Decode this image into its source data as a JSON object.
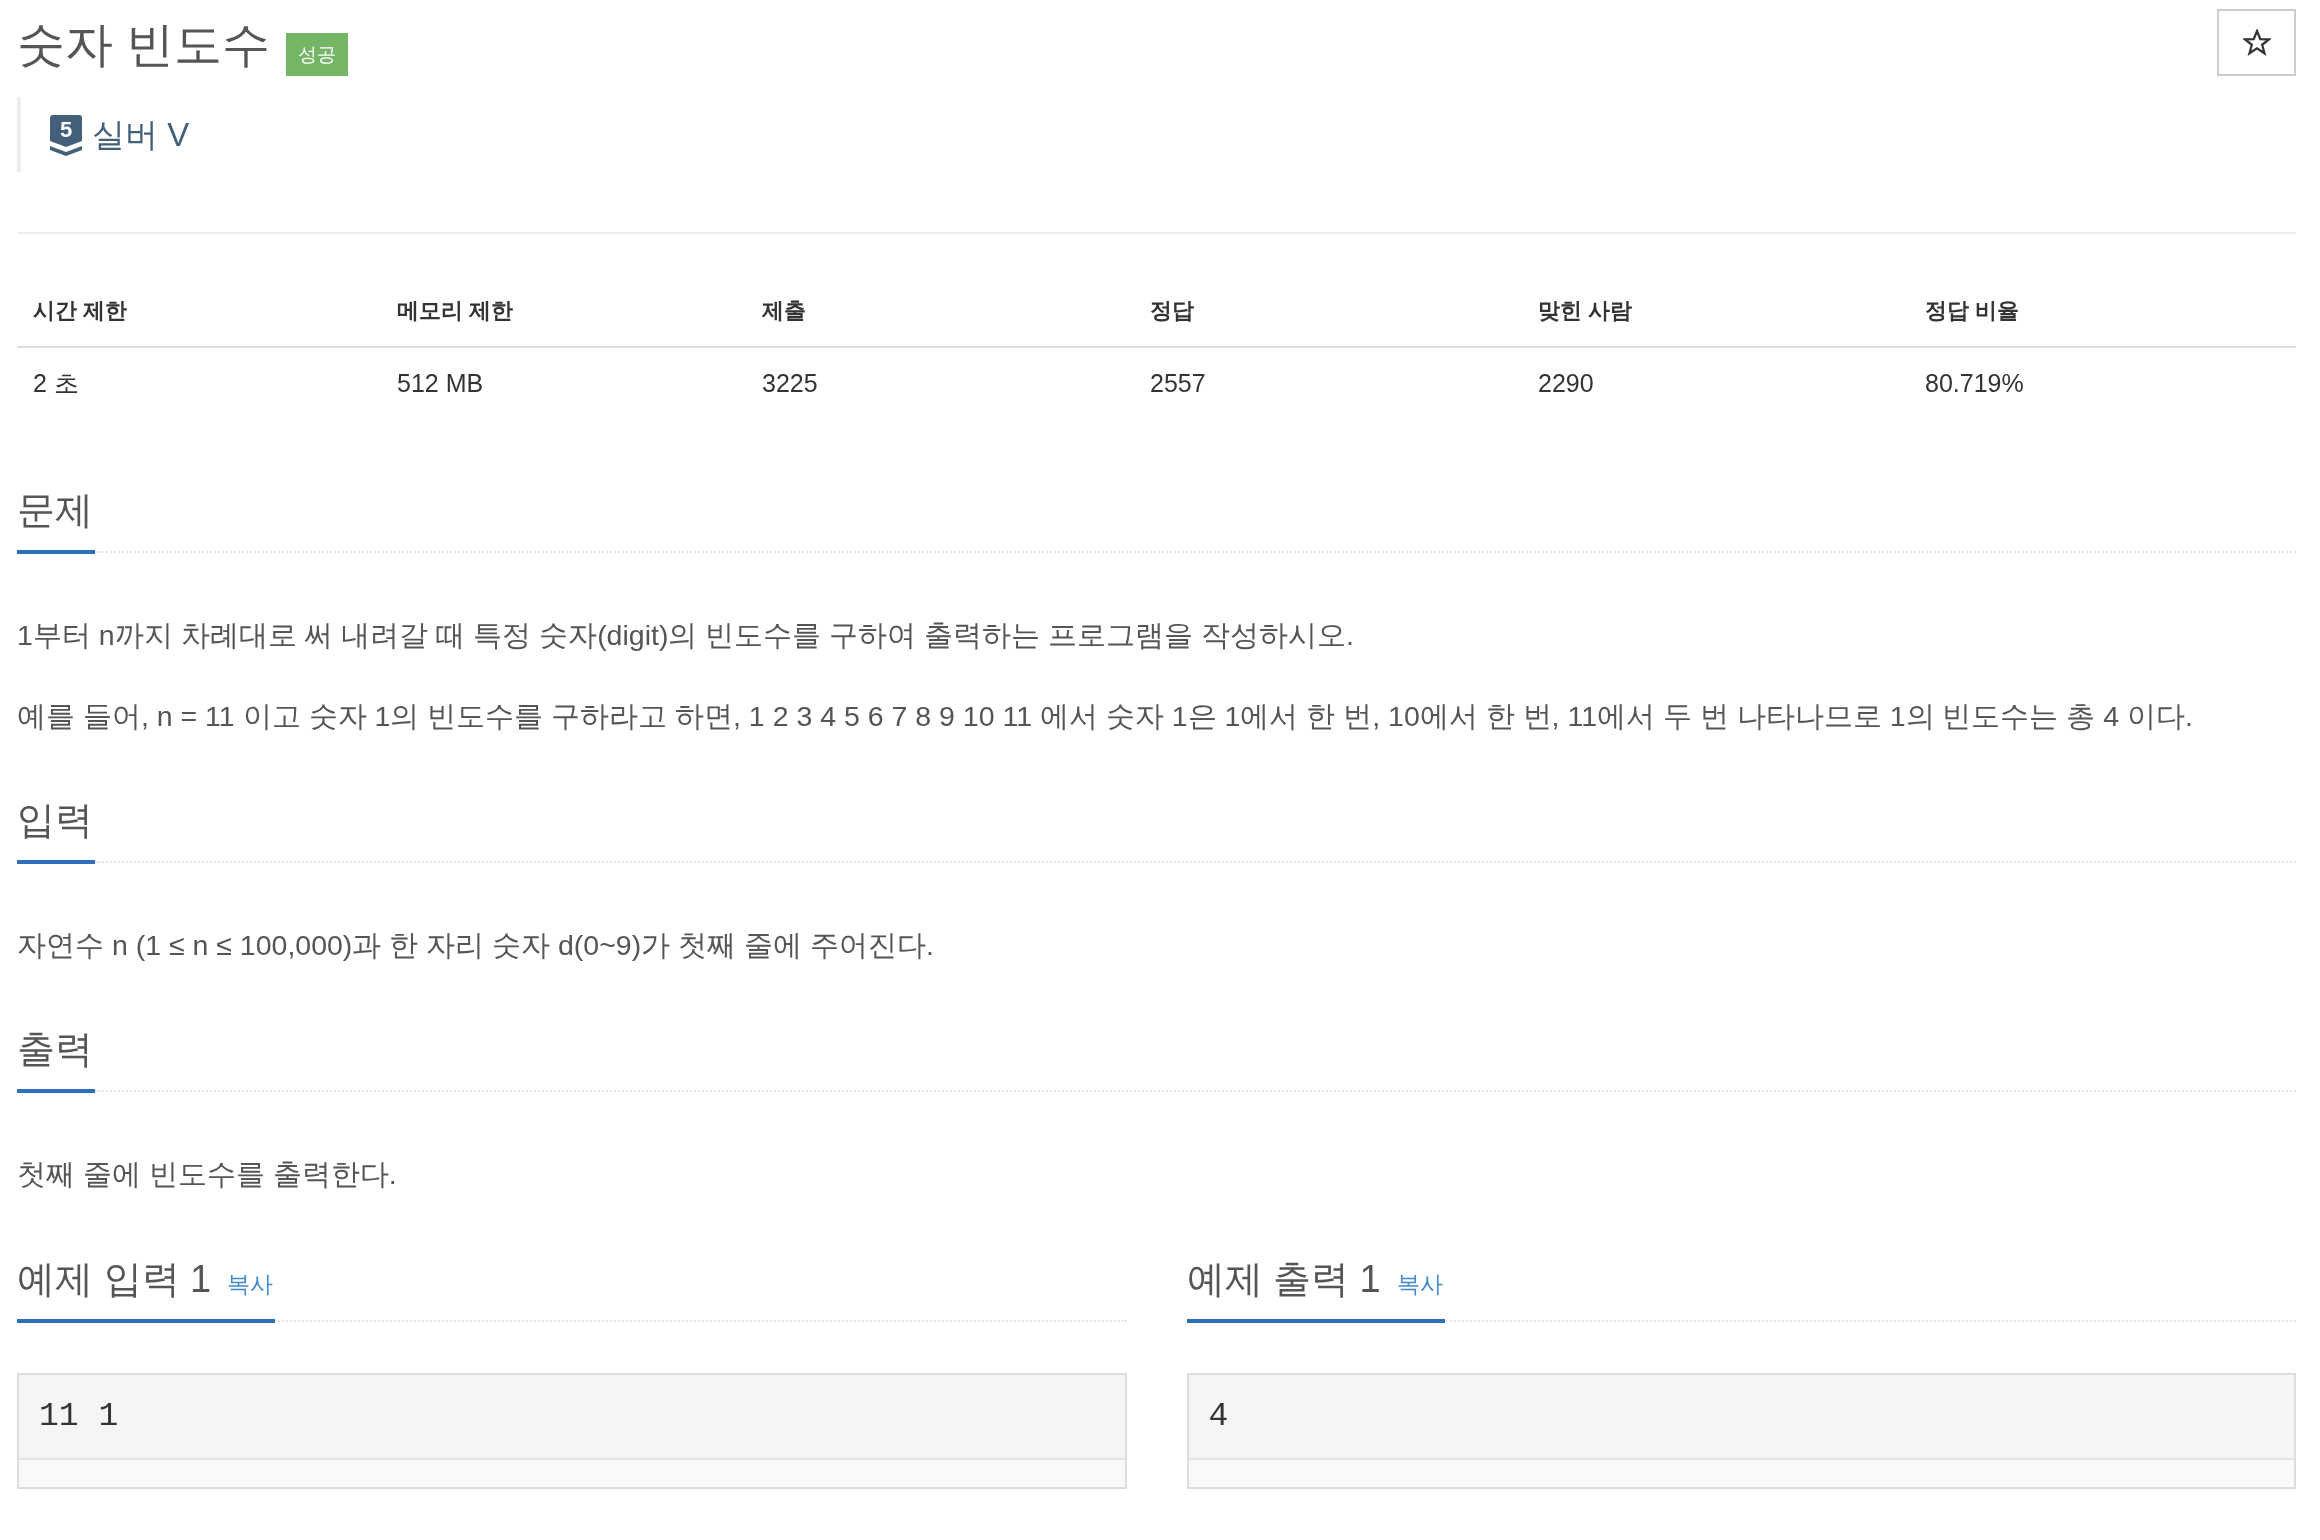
{
  "problem": {
    "title": "숫자 빈도수",
    "result_badge": "성공",
    "starred": false
  },
  "tier": {
    "badge_number": "5",
    "label": "실버 V"
  },
  "stats": {
    "columns": [
      "시간 제한",
      "메모리 제한",
      "제출",
      "정답",
      "맞힌 사람",
      "정답 비율"
    ],
    "rows": [
      [
        "2 초",
        "512 MB",
        "3225",
        "2557",
        "2290",
        "80.719%"
      ]
    ]
  },
  "sections": [
    {
      "heading": "문제",
      "paragraphs": [
        "1부터 n까지 차례대로 써 내려갈 때 특정 숫자(digit)의 빈도수를 구하여 출력하는 프로그램을 작성하시오.",
        "예를 들어, n = 11 이고 숫자 1의 빈도수를 구하라고 하면, 1 2 3 4 5 6 7 8 9 10 11 에서 숫자 1은 1에서 한 번, 10에서 한 번, 11에서 두 번 나타나므로 1의 빈도수는 총 4 이다."
      ]
    },
    {
      "heading": "입력",
      "paragraphs": [
        "자연수 n (1 ≤ n ≤ 100,000)과 한 자리 숫자 d(0~9)가 첫째 줄에 주어진다."
      ]
    },
    {
      "heading": "출력",
      "paragraphs": [
        "첫째 줄에 빈도수를 출력한다."
      ]
    }
  ],
  "samples": [
    {
      "heading": "예제 입력 1",
      "copy_link": "복사",
      "content": "11 1"
    },
    {
      "heading": "예제 출력 1",
      "copy_link": "복사",
      "content": "4"
    }
  ]
}
